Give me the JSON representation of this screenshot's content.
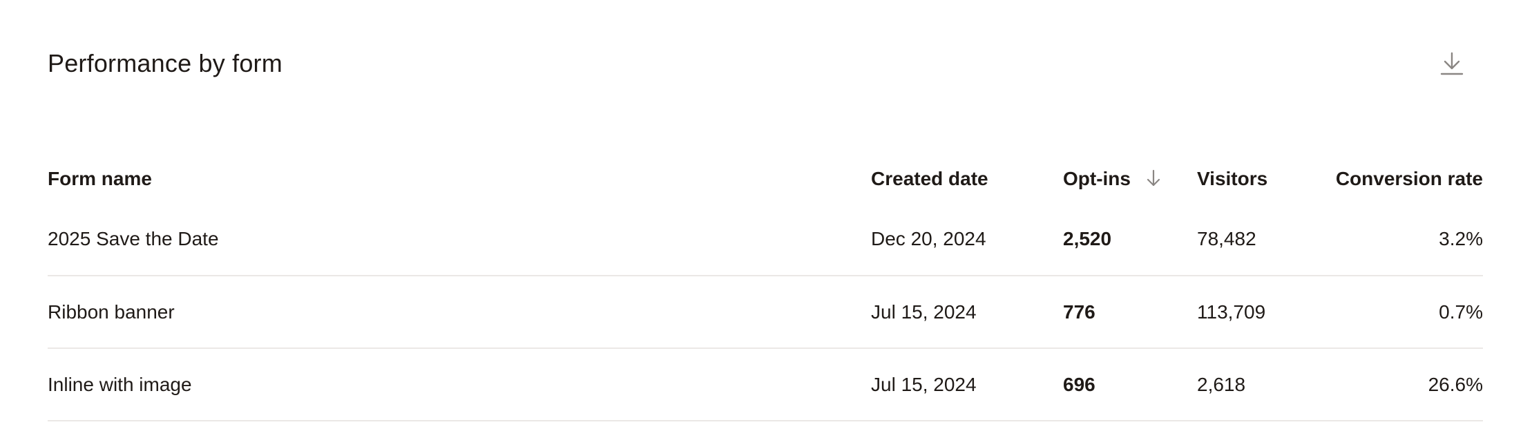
{
  "header": {
    "title": "Performance by form",
    "download_icon": "download-icon"
  },
  "table": {
    "columns": {
      "form_name": "Form name",
      "created_date": "Created date",
      "opt_ins": "Opt-ins",
      "visitors": "Visitors",
      "conversion_rate": "Conversion rate"
    },
    "sort": {
      "column": "Opt-ins",
      "direction": "descending",
      "icon": "arrow-down-icon"
    },
    "rows": [
      {
        "form_name": "2025 Save the Date",
        "created_date": "Dec 20, 2024",
        "opt_ins": "2,520",
        "visitors": "78,482",
        "conversion_rate": "3.2%"
      },
      {
        "form_name": "Ribbon banner",
        "created_date": "Jul 15, 2024",
        "opt_ins": "776",
        "visitors": "113,709",
        "conversion_rate": "0.7%"
      },
      {
        "form_name": "Inline with image",
        "created_date": "Jul 15, 2024",
        "opt_ins": "696",
        "visitors": "2,618",
        "conversion_rate": "26.6%"
      }
    ]
  },
  "colors": {
    "text": "#1f1a17",
    "divider": "#ebe8e6",
    "icon": "#8a8683"
  }
}
